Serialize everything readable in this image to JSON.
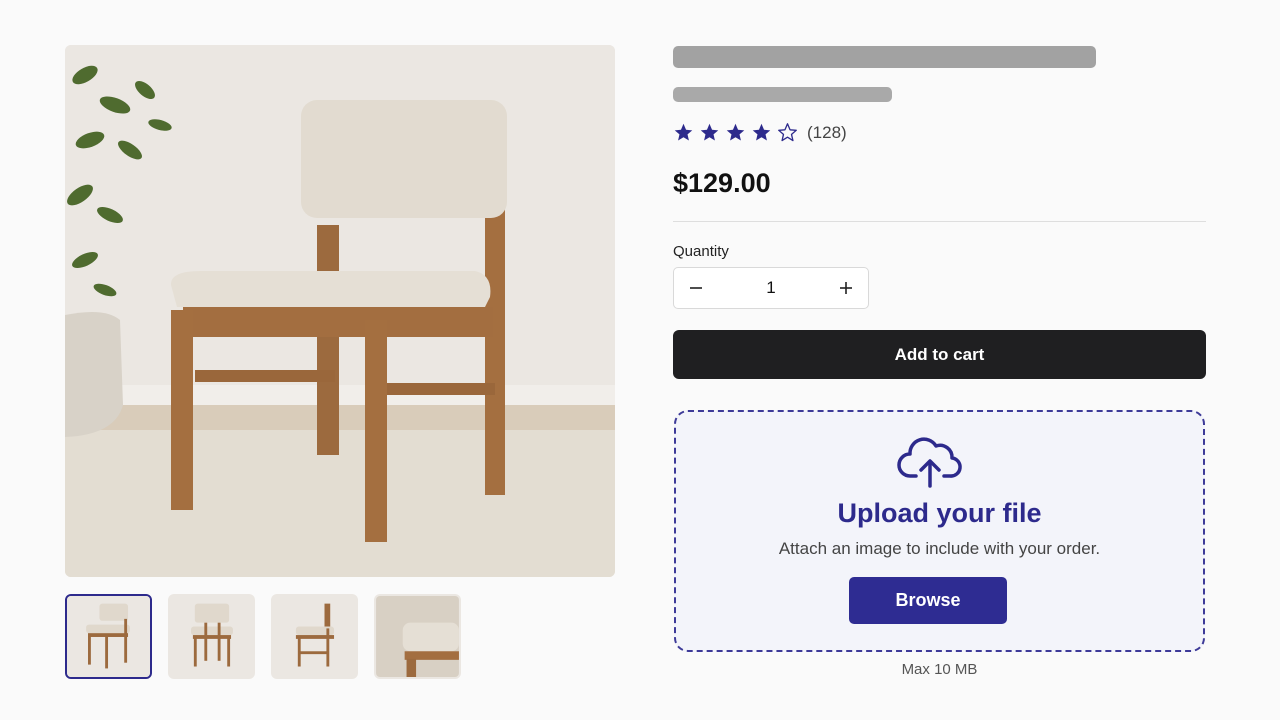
{
  "product": {
    "rating": 4,
    "rating_max": 5,
    "review_count": "(128)",
    "price": "$129.00"
  },
  "quantity": {
    "label": "Quantity",
    "value": "1",
    "decrement_icon": "minus-icon",
    "increment_icon": "plus-icon"
  },
  "cart": {
    "add_label": "Add to cart"
  },
  "upload": {
    "icon": "cloud-upload-icon",
    "title": "Upload your file",
    "description": "Attach an image to include with your order.",
    "browse_label": "Browse",
    "max_size": "Max 10 MB"
  },
  "gallery": {
    "thumbnail_count": 4,
    "selected_index": 0
  },
  "colors": {
    "accent": "#2d2a8c",
    "star": "#2d2a8c",
    "cart_button": "#1f1f21",
    "upload_bg": "#f3f4fa"
  }
}
